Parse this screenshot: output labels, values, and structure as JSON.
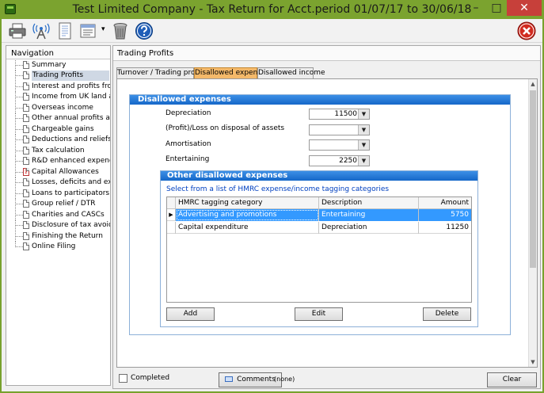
{
  "window": {
    "title": "Test Limited Company - Tax Return for Acct.period 01/07/17 to 30/06/18",
    "minimize_glyph": "–",
    "maximize_glyph": "□",
    "close_glyph": "✕"
  },
  "toolbar": {
    "icons": [
      "printer-icon",
      "broadcast-icon",
      "document-list-icon",
      "dropdown-menu-icon",
      "trash-icon",
      "help-icon",
      "exit-icon"
    ],
    "dropdown_glyph": "▾"
  },
  "navigation": {
    "header": "Navigation",
    "items": [
      {
        "label": "Summary",
        "selected": false,
        "icon": "document-icon"
      },
      {
        "label": "Trading Profits",
        "selected": true,
        "icon": "document-icon"
      },
      {
        "label": "Interest and profits fro...",
        "selected": false,
        "icon": "document-icon"
      },
      {
        "label": "Income from UK land an...",
        "selected": false,
        "icon": "document-icon"
      },
      {
        "label": "Overseas income",
        "selected": false,
        "icon": "document-icon"
      },
      {
        "label": "Other annual profits an...",
        "selected": false,
        "icon": "document-icon"
      },
      {
        "label": "Chargeable gains",
        "selected": false,
        "icon": "document-icon"
      },
      {
        "label": "Deductions and reliefs",
        "selected": false,
        "icon": "document-icon"
      },
      {
        "label": "Tax calculation",
        "selected": false,
        "icon": "document-icon"
      },
      {
        "label": "R&D enhanced expendit...",
        "selected": false,
        "icon": "document-icon"
      },
      {
        "label": "Capital Allowances",
        "selected": false,
        "icon": "document-warning-icon"
      },
      {
        "label": "Losses, deficits and exc...",
        "selected": false,
        "icon": "document-icon"
      },
      {
        "label": "Loans to participators",
        "selected": false,
        "icon": "document-icon"
      },
      {
        "label": "Group relief / DTR",
        "selected": false,
        "icon": "document-icon"
      },
      {
        "label": "Charities and CASCs",
        "selected": false,
        "icon": "document-icon"
      },
      {
        "label": "Disclosure of tax avoida...",
        "selected": false,
        "icon": "document-icon"
      },
      {
        "label": "Finishing the Return",
        "selected": false,
        "icon": "document-icon"
      },
      {
        "label": "Online Filing",
        "selected": false,
        "icon": "document-icon"
      }
    ]
  },
  "main": {
    "header": "Trading Profits",
    "tabs": [
      {
        "label": "Turnover / Trading profits",
        "active": false
      },
      {
        "label": "Disallowed expenses",
        "active": true
      },
      {
        "label": "Disallowed income",
        "active": false
      }
    ],
    "disallowed": {
      "title": "Disallowed expenses",
      "fields": [
        {
          "label": "Depreciation",
          "value": "11500"
        },
        {
          "label": "(Profit)/Loss on disposal of assets",
          "value": ""
        },
        {
          "label": "Amortisation",
          "value": ""
        },
        {
          "label": "Entertaining",
          "value": "2250"
        }
      ],
      "dropdown_glyph": "▼"
    },
    "other": {
      "title": "Other disallowed expenses",
      "link": "Select from a list of HMRC expense/income tagging categories",
      "columns": [
        "HMRC tagging category",
        "Description",
        "Amount"
      ],
      "rows": [
        {
          "category": "Advertising and promotions",
          "description": "Entertaining",
          "amount": "5750",
          "selected": true
        },
        {
          "category": "Capital expenditure",
          "description": "Depreciation",
          "amount": "11250",
          "selected": false
        }
      ],
      "row_pointer": "▶",
      "buttons": {
        "add": "Add",
        "edit": "Edit",
        "delete": "Delete"
      }
    },
    "scroll_up_glyph": "▲",
    "scroll_down_glyph": "▼"
  },
  "footer": {
    "completed_label": "Completed",
    "completed_checked": false,
    "comments_label": "Comments",
    "comments_note": "(none)",
    "clear_label": "Clear"
  },
  "colors": {
    "title_bar": "#7ba32f",
    "section_header": "#1567c8",
    "active_tab": "#f4b96a",
    "selection": "#3399ff",
    "close_button": "#c7403a"
  }
}
